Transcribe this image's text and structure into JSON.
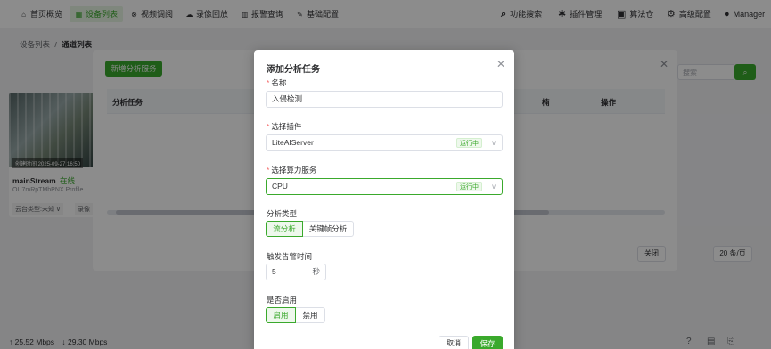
{
  "nav": {
    "left": [
      {
        "icon": "home-icon",
        "glyph": "⌂",
        "label": "首页概览"
      },
      {
        "icon": "list-icon",
        "glyph": "▦",
        "label": "设备列表"
      },
      {
        "icon": "video-icon",
        "glyph": "⊗",
        "label": "视频调阅"
      },
      {
        "icon": "cloud-icon",
        "glyph": "☁",
        "label": "录像回放"
      },
      {
        "icon": "alarm-icon",
        "glyph": "▥",
        "label": "报警查询"
      },
      {
        "icon": "edit-icon",
        "glyph": "✎",
        "label": "基础配置"
      }
    ],
    "right": [
      {
        "icon": "search-icon",
        "glyph": "🔍",
        "label": "功能搜索"
      },
      {
        "icon": "puzzle-icon",
        "glyph": "✱",
        "label": "插件管理"
      },
      {
        "icon": "box-icon",
        "glyph": "▣",
        "label": "算法仓"
      },
      {
        "icon": "gear-icon",
        "glyph": "⚙",
        "label": "高级配置"
      },
      {
        "icon": "user-icon",
        "glyph": "👤",
        "label": "Manager"
      }
    ]
  },
  "breadcrumb": {
    "parent": "设备列表",
    "sep": "/",
    "current": "通道列表"
  },
  "device_card": {
    "timestamp": "创建时间 2025-09-27 16:50",
    "name": "mainStream",
    "status": "在线",
    "sub": "OU7mRpTMbPNX Profile",
    "tag_left": "云台类型:未知 ∨",
    "tag_right": "录像"
  },
  "stats": {
    "up": "↑ 25.52 Mbps",
    "down": "↓ 29.30 Mbps"
  },
  "bg_dialog": {
    "add_button": "新增分析服务",
    "columns": [
      "分析任务",
      "楠",
      "操作"
    ],
    "close_button": "关闭",
    "page_size": "20 条/页",
    "search_placeholder": "搜索"
  },
  "modal": {
    "title": "添加分析任务",
    "name_label": "名称",
    "name_value": "入侵检测",
    "plugin_label": "选择插件",
    "plugin_value": "LiteAIServer",
    "plugin_status": "运行中",
    "compute_label": "选择算力服务",
    "compute_value": "CPU",
    "compute_status": "运行中",
    "analysis_type_label": "分析类型",
    "analysis_types": [
      "流分析",
      "关键帧分析"
    ],
    "alarm_time_label": "触发告警时间",
    "alarm_time_value": "5",
    "alarm_time_unit": "秒",
    "enable_label": "是否启用",
    "enable_options": [
      "启用",
      "禁用"
    ],
    "cancel_button": "取消",
    "save_button": "保存"
  },
  "colors": {
    "accent": "#3aa92c",
    "required": "#f56c6c"
  }
}
